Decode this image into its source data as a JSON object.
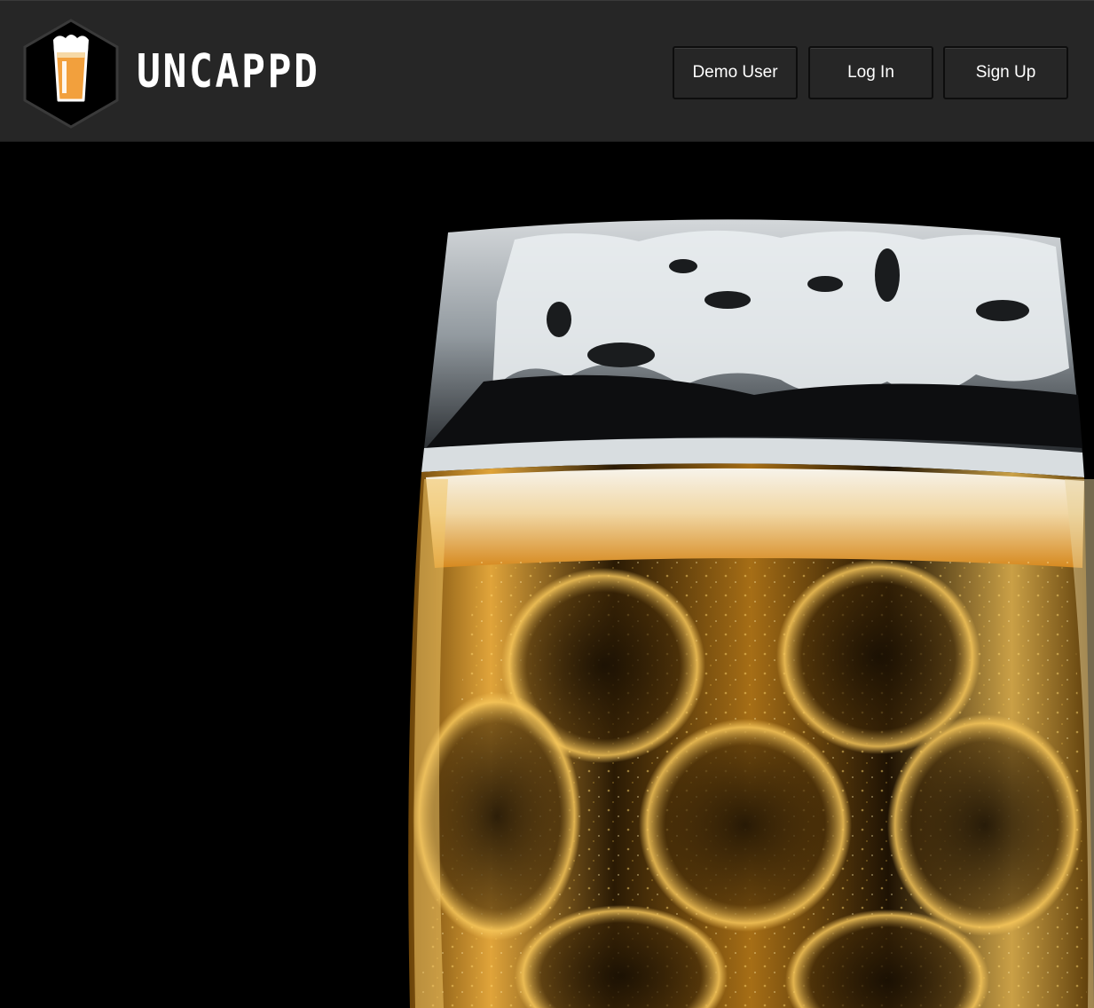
{
  "header": {
    "brand_name": "UNCAPPD",
    "logo_icon": "beer-glass-hexagon-logo",
    "buttons": {
      "demo_label": "Demo User",
      "login_label": "Log In",
      "signup_label": "Sign Up"
    }
  },
  "hero": {
    "image_subject": "beer-mug-photo"
  },
  "colors": {
    "navbar_bg": "#262626",
    "page_bg": "#000000",
    "beer_amber": "#f2a03d",
    "text": "#ffffff"
  }
}
